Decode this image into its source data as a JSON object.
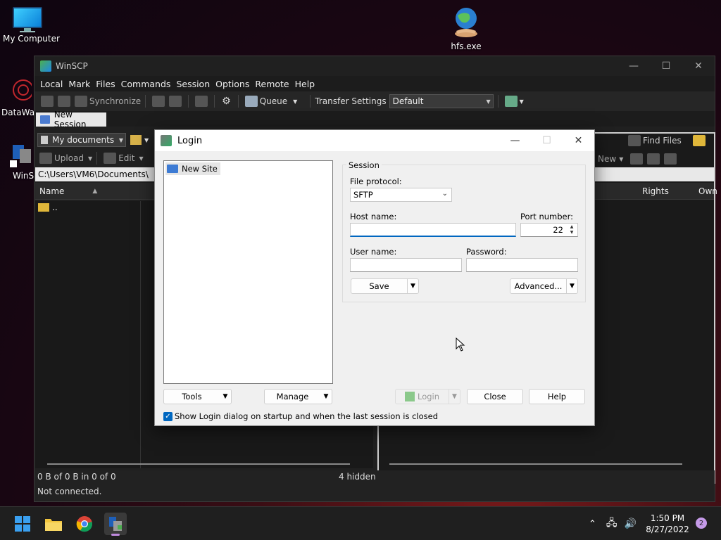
{
  "desktop": {
    "icons": [
      {
        "label": "My Computer"
      },
      {
        "label": "hfs.exe"
      },
      {
        "label": "DataWag"
      },
      {
        "label": "WinSC"
      }
    ]
  },
  "winscp": {
    "title": "WinSCP",
    "menu": [
      "Local",
      "Mark",
      "Files",
      "Commands",
      "Session",
      "Options",
      "Remote",
      "Help"
    ],
    "toolbar": {
      "synchronize": "Synchronize",
      "queue": "Queue",
      "transfer_settings_label": "Transfer Settings",
      "transfer_settings_value": "Default"
    },
    "tab_new_session": "New Session",
    "left_panel": {
      "location": "My documents",
      "upload": "Upload",
      "edit": "Edit",
      "path": "C:\\Users\\VM6\\Documents\\",
      "col_name": "Name",
      "parent_dir": ".."
    },
    "right_panel": {
      "find_files": "Find Files",
      "new": "New",
      "col_rights": "Rights",
      "col_owner": "Own"
    },
    "status": {
      "left": "0 B of 0 B in 0 of 0",
      "hidden": "4 hidden",
      "connection": "Not connected."
    }
  },
  "login": {
    "title": "Login",
    "site_tree": {
      "new_site": "New Site"
    },
    "session_group": "Session",
    "file_protocol_label": "File protocol:",
    "file_protocol_value": "SFTP",
    "host_label": "Host name:",
    "host_value": "",
    "port_label": "Port number:",
    "port_value": "22",
    "user_label": "User name:",
    "user_value": "",
    "password_label": "Password:",
    "password_value": "",
    "save_button": "Save",
    "advanced_button": "Advanced...",
    "tools_button": "Tools",
    "manage_button": "Manage",
    "login_button": "Login",
    "close_button": "Close",
    "help_button": "Help",
    "show_login_checkbox": "Show Login dialog on startup and when the last session is closed"
  },
  "taskbar": {
    "time": "1:50 PM",
    "date": "8/27/2022",
    "notifications": "2"
  },
  "colors": {
    "accent": "#0067c0",
    "dialog_bg": "#f0f0f0",
    "dark_window": "#202020"
  }
}
